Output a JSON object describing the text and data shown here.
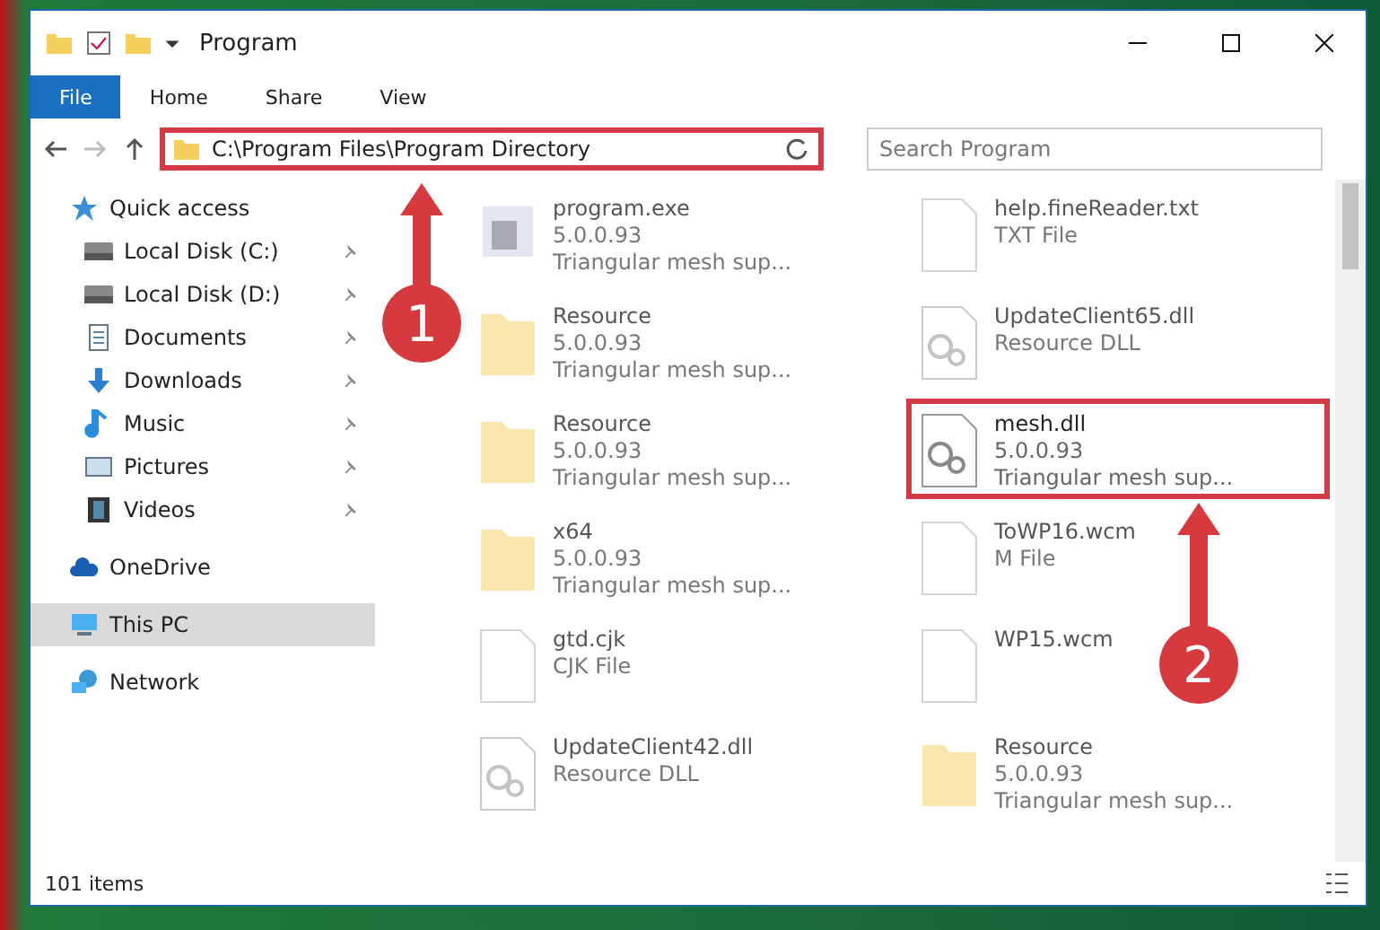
{
  "window": {
    "title": "Program"
  },
  "ribbon_tabs": [
    {
      "label": "File",
      "selected": true
    },
    {
      "label": "Home",
      "selected": false
    },
    {
      "label": "Share",
      "selected": false
    },
    {
      "label": "View",
      "selected": false
    }
  ],
  "address": {
    "path": "C:\\Program Files\\Program Directory",
    "highlighted": true
  },
  "search": {
    "placeholder": "Search Program"
  },
  "sidebar": {
    "items": [
      {
        "label": "Quick access",
        "kind": "star",
        "pinned": false,
        "selected": false,
        "child": false
      },
      {
        "label": "Local Disk (C:)",
        "kind": "disk",
        "pinned": true,
        "selected": false,
        "child": true
      },
      {
        "label": "Local Disk (D:)",
        "kind": "disk",
        "pinned": true,
        "selected": false,
        "child": true
      },
      {
        "label": "Documents",
        "kind": "doc",
        "pinned": true,
        "selected": false,
        "child": true
      },
      {
        "label": "Downloads",
        "kind": "download",
        "pinned": true,
        "selected": false,
        "child": true
      },
      {
        "label": "Music",
        "kind": "music",
        "pinned": true,
        "selected": false,
        "child": true
      },
      {
        "label": "Pictures",
        "kind": "picture",
        "pinned": true,
        "selected": false,
        "child": true
      },
      {
        "label": "Videos",
        "kind": "video",
        "pinned": true,
        "selected": false,
        "child": true
      },
      {
        "label": "OneDrive",
        "kind": "cloud",
        "pinned": false,
        "selected": false,
        "child": false
      },
      {
        "label": "This PC",
        "kind": "pc",
        "pinned": false,
        "selected": true,
        "child": false
      },
      {
        "label": "Network",
        "kind": "network",
        "pinned": false,
        "selected": false,
        "child": false
      }
    ]
  },
  "files": [
    {
      "kind": "exe",
      "name": "program.exe",
      "lines": [
        "5.0.0.93",
        "Triangular mesh sup..."
      ],
      "dimmed": true,
      "highlighted": false
    },
    {
      "kind": "text",
      "name": "help.fineReader.txt",
      "lines": [
        "TXT File"
      ],
      "dimmed": true,
      "highlighted": false
    },
    {
      "kind": "folder",
      "name": "Resource",
      "lines": [
        "5.0.0.93",
        "Triangular mesh sup..."
      ],
      "dimmed": true,
      "highlighted": false
    },
    {
      "kind": "dll",
      "name": "UpdateClient65.dll",
      "lines": [
        "Resource DLL"
      ],
      "dimmed": true,
      "highlighted": false
    },
    {
      "kind": "folder",
      "name": "Resource",
      "lines": [
        "5.0.0.93",
        "Triangular mesh sup..."
      ],
      "dimmed": true,
      "highlighted": false
    },
    {
      "kind": "dll",
      "name": "mesh.dll",
      "lines": [
        "5.0.0.93",
        "Triangular mesh sup..."
      ],
      "dimmed": false,
      "highlighted": true
    },
    {
      "kind": "folder",
      "name": "x64",
      "lines": [
        "5.0.0.93",
        "Triangular mesh sup..."
      ],
      "dimmed": true,
      "highlighted": false
    },
    {
      "kind": "text",
      "name": "ToWP16.wcm",
      "lines": [
        "M File"
      ],
      "dimmed": true,
      "highlighted": false
    },
    {
      "kind": "text",
      "name": "gtd.cjk",
      "lines": [
        "CJK File"
      ],
      "dimmed": true,
      "highlighted": false
    },
    {
      "kind": "text",
      "name": "WP15.wcm",
      "dimmed": true,
      "highlighted": false
    },
    {
      "kind": "dll",
      "name": "UpdateClient42.dll",
      "lines": [
        "Resource DLL"
      ],
      "dimmed": true,
      "highlighted": false
    },
    {
      "kind": "folder",
      "name": "Resource",
      "lines": [
        "5.0.0.93",
        "Triangular mesh sup..."
      ],
      "dimmed": true,
      "highlighted": false
    }
  ],
  "annotations": [
    {
      "label": "1"
    },
    {
      "label": "2"
    }
  ],
  "status_bar": {
    "count": "101 items"
  }
}
